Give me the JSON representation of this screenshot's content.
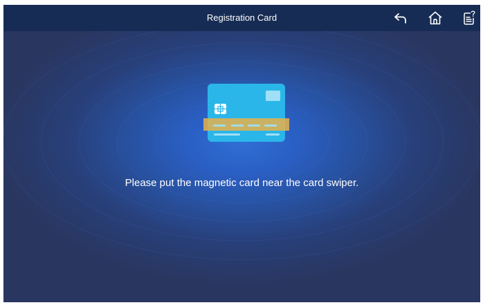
{
  "header": {
    "title": "Registration Card",
    "back_icon": "back-arrow-icon",
    "home_icon": "home-icon",
    "manual_icon": "help-document-icon"
  },
  "main": {
    "card_icon": "magnetic-card-icon",
    "instruction": "Please put the magnetic card near the card swiper."
  },
  "colors": {
    "header_bg": "#172c54",
    "background_center": "#2f6fd6",
    "background_edge": "#29365f",
    "card": "#2bb6ea",
    "magnetic_stripe": "#e6b24a",
    "text": "#ffffff"
  }
}
